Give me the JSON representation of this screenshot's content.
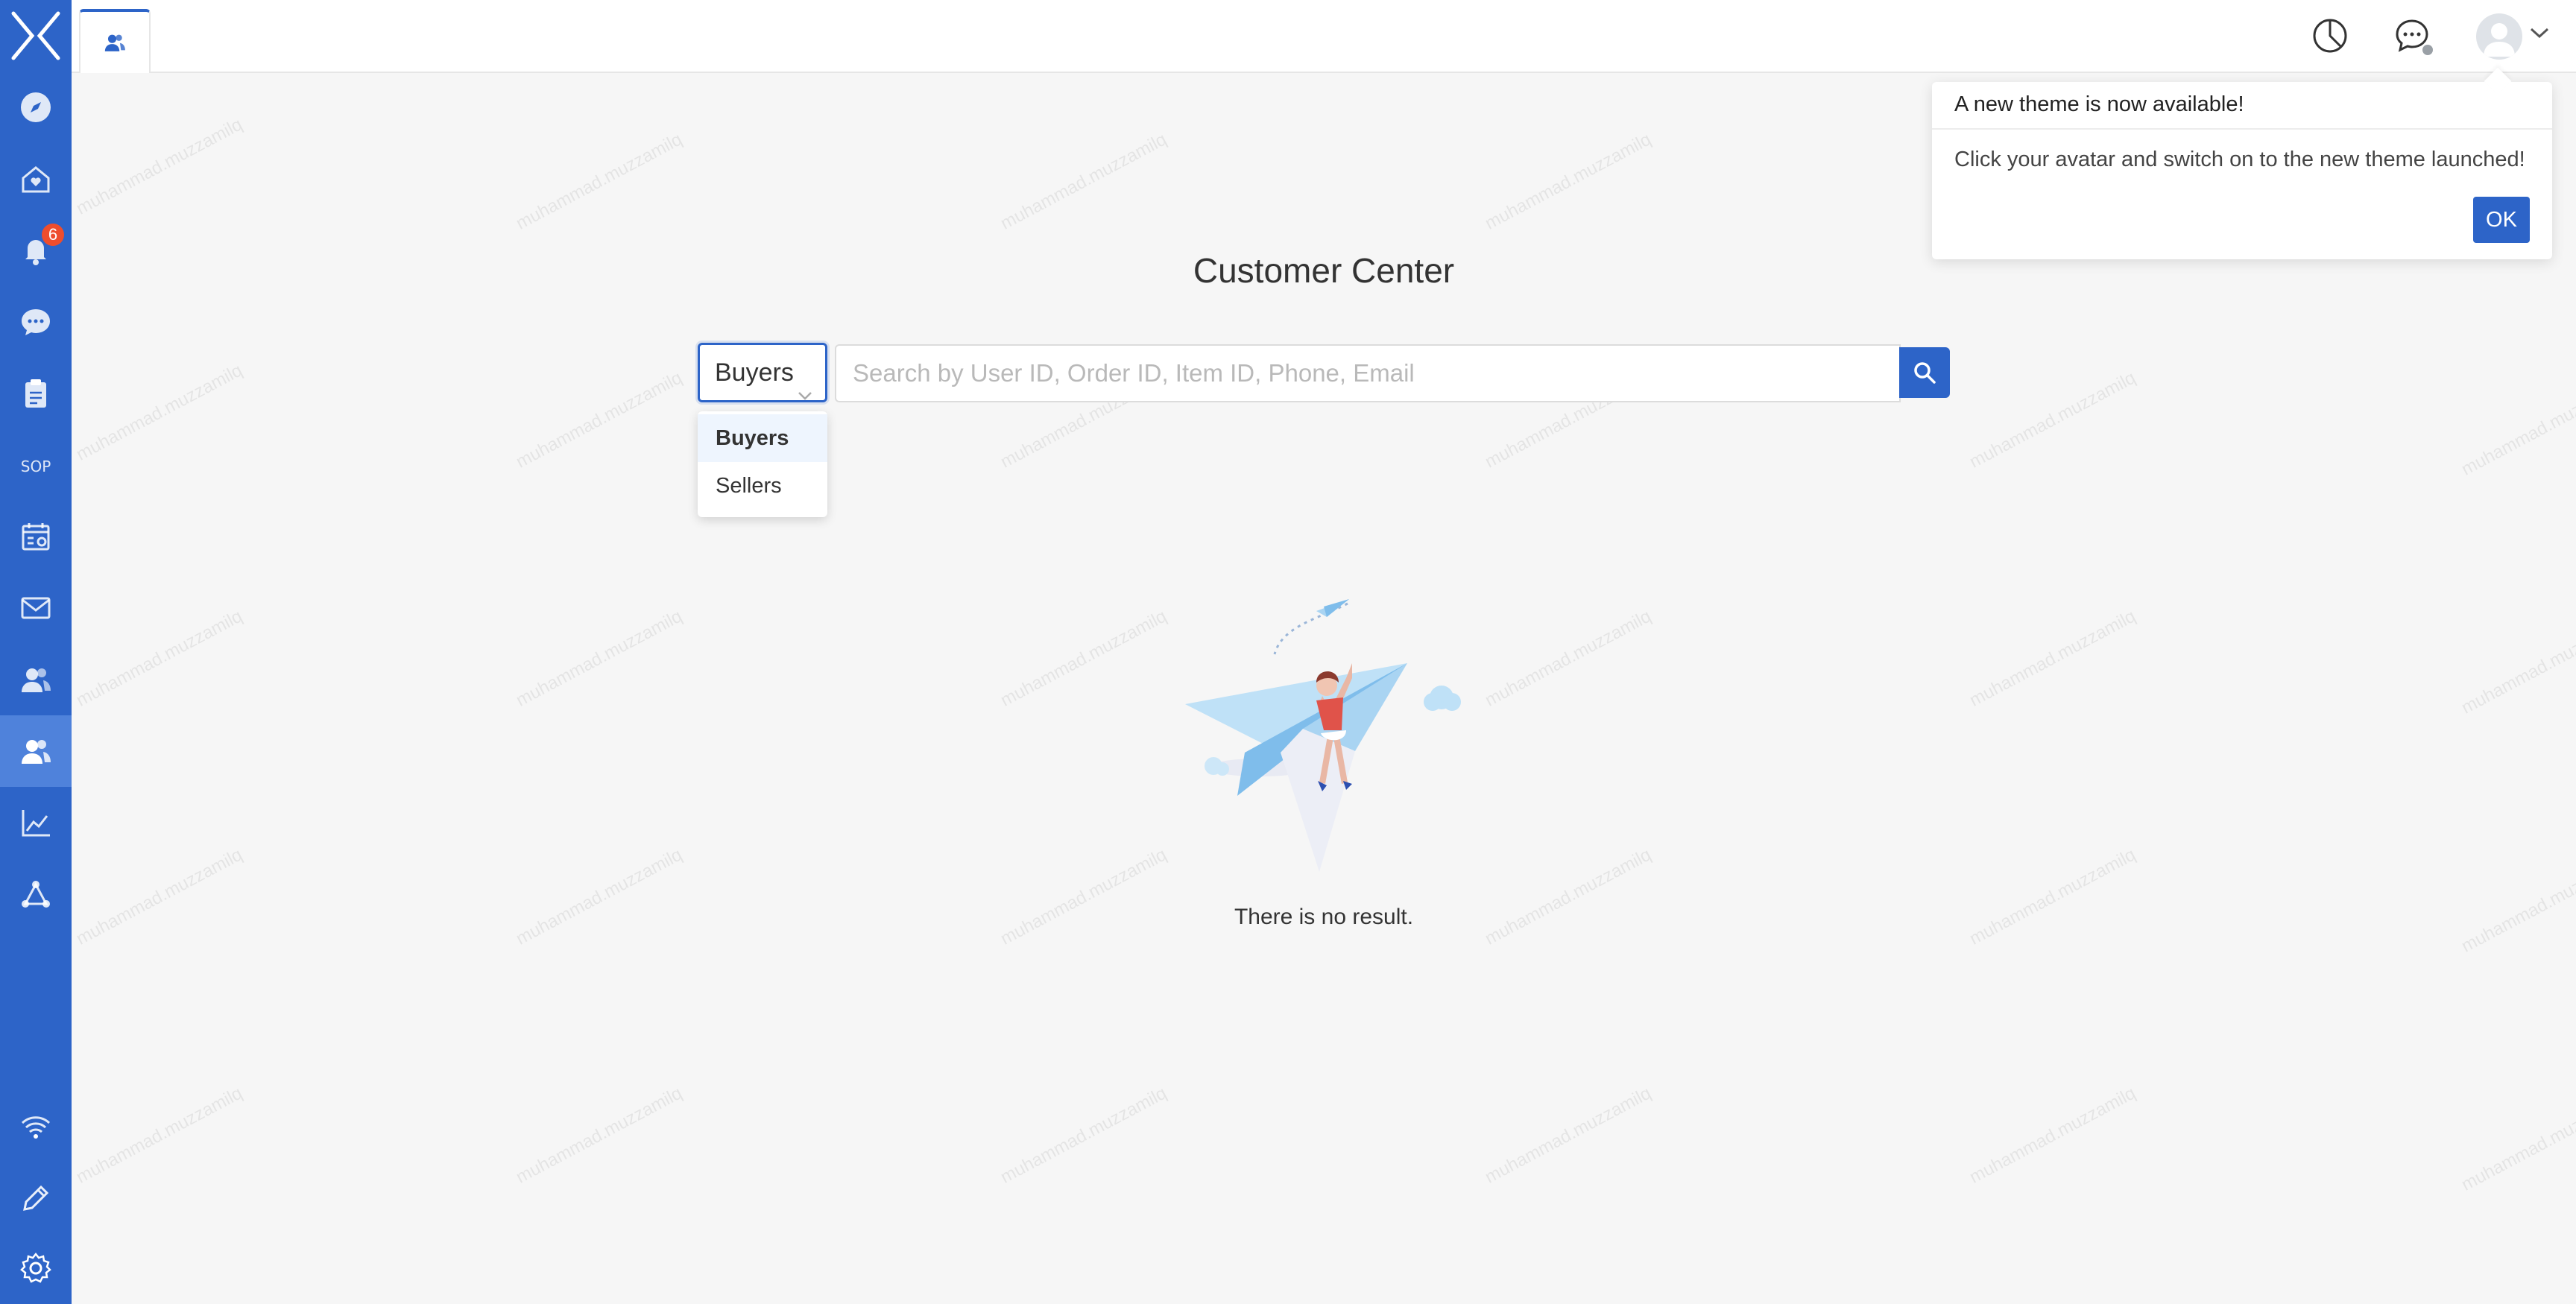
{
  "sidebar": {
    "notification_count": "6",
    "sop_label": "SOP",
    "items": [
      "logo-icon",
      "compass-icon",
      "home-heart-icon",
      "bell-icon",
      "chat-icon",
      "clipboard-icon",
      "sop-icon",
      "calendar-icon",
      "mail-icon",
      "users-icon",
      "customer-center-icon",
      "chart-icon",
      "network-icon",
      "wifi-icon",
      "pencil-icon",
      "gear-icon"
    ]
  },
  "topbar": {
    "active_tab_icon": "customer-icon"
  },
  "main": {
    "title": "Customer Center",
    "select_value": "Buyers",
    "dropdown_options": [
      "Buyers",
      "Sellers"
    ],
    "search_placeholder": "Search by User ID, Order ID, Item ID, Phone, Email",
    "empty_text": "There is no result."
  },
  "popover": {
    "title": "A new theme is now available!",
    "body": "Click your avatar and switch on to the new theme launched!",
    "ok_label": "OK"
  },
  "watermark": "muhammad.muzzamilq",
  "colors": {
    "brand": "#2d64c8",
    "badge": "#ee4d2d"
  }
}
